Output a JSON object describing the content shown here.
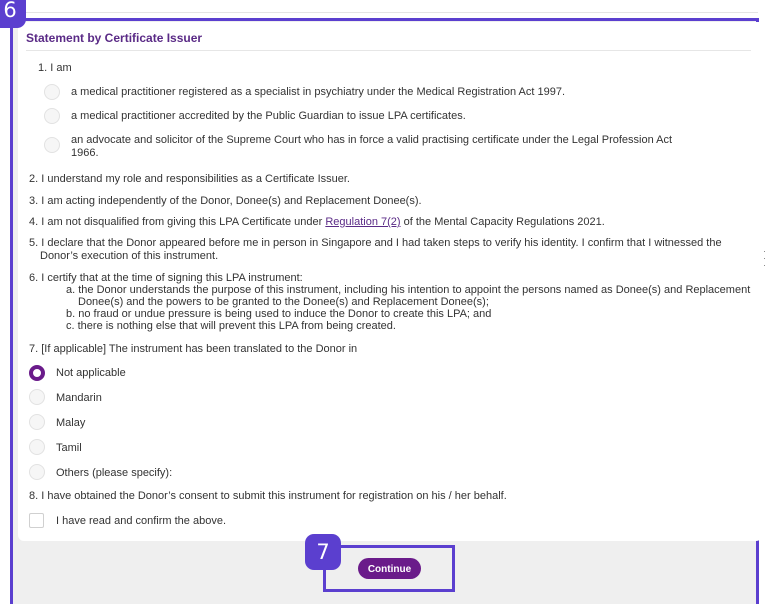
{
  "badges": {
    "step6": "6",
    "step7": "7"
  },
  "section": {
    "title": "Statement by Certificate Issuer"
  },
  "statements": {
    "s1": "1. I am",
    "s1_options": [
      "a medical practitioner registered as a specialist in psychiatry under the Medical Registration Act 1997.",
      "a medical practitioner accredited by the Public Guardian to issue LPA certificates.",
      "an advocate and solicitor of the Supreme Court who has in force a valid practising certificate under the Legal Profession Act",
      "1966."
    ],
    "s2": "2. I understand my role and responsibilities as a Certificate Issuer.",
    "s3": "3. I am acting independently of the Donor, Donee(s) and Replacement Donee(s).",
    "s4_pre": "4. I am not disqualified from giving this LPA Certificate under ",
    "s4_link": "Regulation 7(2)",
    "s4_post": " of the Mental Capacity Regulations 2021.",
    "s5_line1": "5. I declare that the Donor appeared before me in person in Singapore and I had taken steps to verify his identity. I confirm that I witnessed the",
    "s5_line2": "Donor’s execution of this instrument.",
    "s6_intro": "6. I certify that at the time of signing this LPA instrument:",
    "s6_a1": "a. the Donor understands the purpose of this instrument, including his intention to appoint the persons named as Donee(s) and Replacement",
    "s6_a2": "Donee(s) and the powers to be granted to the Donee(s) and Replacement Donee(s);",
    "s6_b": "b. no fraud or undue pressure is being used to induce the Donor to create this LPA; and",
    "s6_c": "c. there is nothing else that will prevent this LPA from being created.",
    "s7": "7. [If applicable] The instrument has been translated to the Donor in",
    "s7_options": [
      "Not applicable",
      "Mandarin",
      "Malay",
      "Tamil",
      "Others (please specify):"
    ],
    "s7_selected": "Not applicable",
    "s8": "8. I have obtained the Donor’s consent to submit this instrument for registration on his / her behalf."
  },
  "confirm": {
    "label": "I have read and confirm the above.",
    "checked": false
  },
  "actions": {
    "continue_label": "Continue"
  },
  "colors": {
    "highlight": "#5b3fcf",
    "brand": "#6a1b8a",
    "title": "#5a2a86"
  }
}
